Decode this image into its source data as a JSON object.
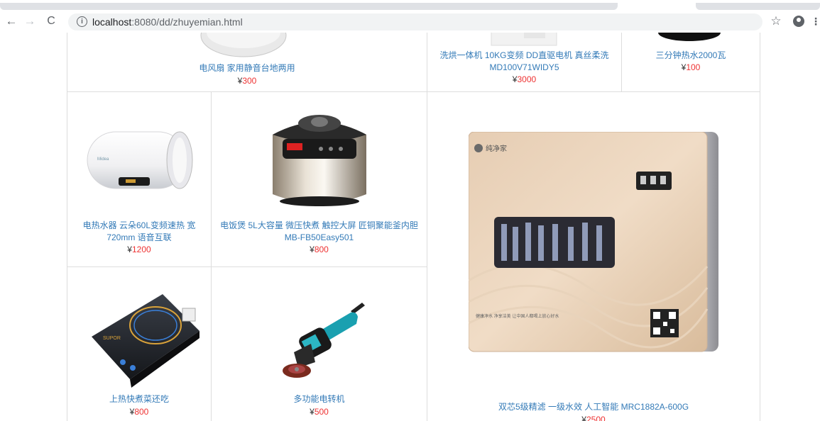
{
  "browser": {
    "url_host": "localhost",
    "url_path": ":8080/dd/zhuyemian.html",
    "back_icon": "back-arrow-icon",
    "forward_icon": "forward-arrow-icon",
    "reload_icon": "reload-icon",
    "info_icon": "info-icon",
    "star_icon": "star-icon",
    "profile_icon": "profile-icon",
    "menu_icon": "menu-icon"
  },
  "currency": "¥",
  "products": [
    {
      "title": "电风扇 家用静音台地两用",
      "price": "300"
    },
    {
      "title": "洗烘一体机 10KG变频 DD直驱电机 真丝柔洗 MD100V71WIDY5",
      "price": "3000"
    },
    {
      "title": "三分钟热水2000瓦",
      "price": "100"
    },
    {
      "title": "电热水器 云朵60L变频速热 宽720mm 语音互联",
      "price": "1200"
    },
    {
      "title": "电饭煲 5L大容量 微压快煮 触控大屏 匠铜聚能釜内胆 MB-FB50Easy501",
      "price": "800"
    },
    {
      "title": "双芯5级精滤 一级水效 人工智能 MRC1882A-600G",
      "price": "2500"
    },
    {
      "title": "上热快煮菜还吃",
      "price": "800"
    },
    {
      "title": "多功能电转机",
      "price": "500"
    }
  ],
  "purifier_brand": "纯净家",
  "purifier_slogan": "健康净水 净享洁美 让中国人都喝上放心好水",
  "cooktop_brand": "SUPOR"
}
